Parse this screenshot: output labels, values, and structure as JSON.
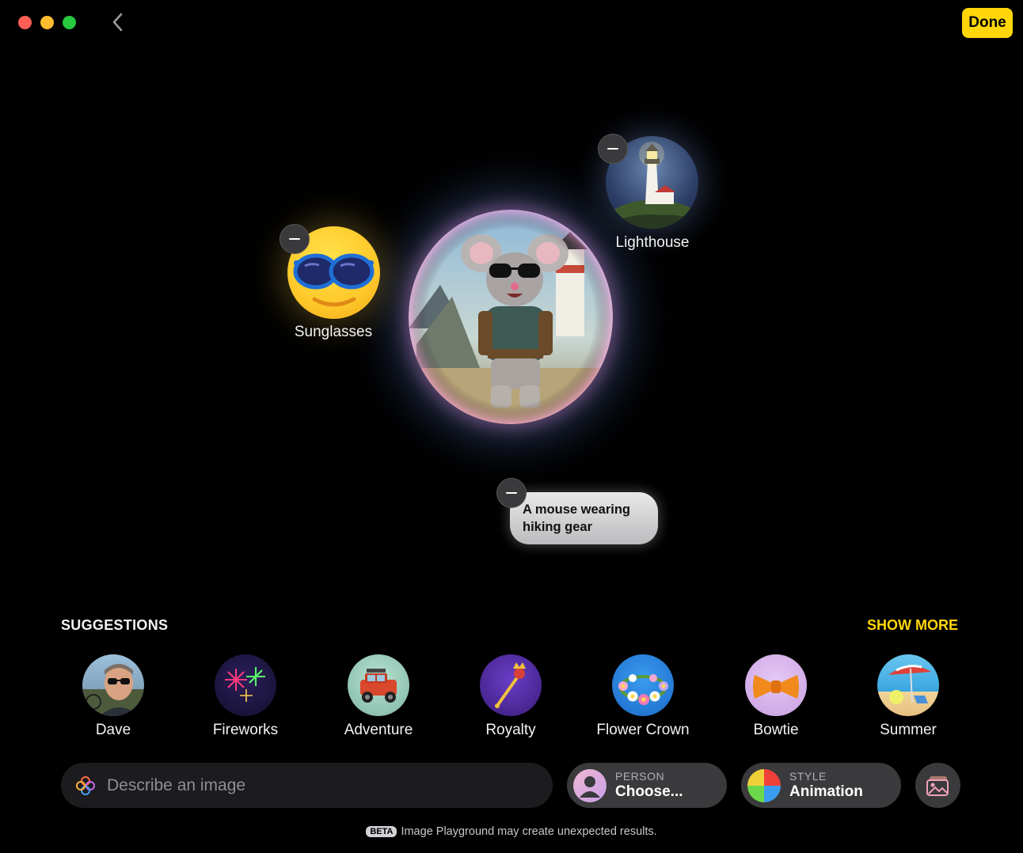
{
  "window": {
    "done_label": "Done"
  },
  "canvas": {
    "concepts": [
      {
        "label": "Sunglasses",
        "icon": "sunglasses-emoji-icon"
      },
      {
        "label": "Lighthouse",
        "icon": "lighthouse-image-icon"
      }
    ],
    "prompt_text": "A mouse wearing hiking gear",
    "main_image": "mouse-hiker-image"
  },
  "suggestions": {
    "title": "SUGGESTIONS",
    "show_more": "SHOW MORE",
    "items": [
      {
        "label": "Dave"
      },
      {
        "label": "Fireworks"
      },
      {
        "label": "Adventure"
      },
      {
        "label": "Royalty"
      },
      {
        "label": "Flower Crown"
      },
      {
        "label": "Bowtie"
      },
      {
        "label": "Summer"
      }
    ]
  },
  "bottom_bar": {
    "placeholder": "Describe an image",
    "person": {
      "caption": "PERSON",
      "value": "Choose..."
    },
    "style": {
      "caption": "STYLE",
      "value": "Animation"
    }
  },
  "footer": {
    "badge": "BETA",
    "text": "Image Playground may create unexpected results."
  },
  "colors": {
    "accent": "#ffd60a",
    "background": "#000000"
  }
}
